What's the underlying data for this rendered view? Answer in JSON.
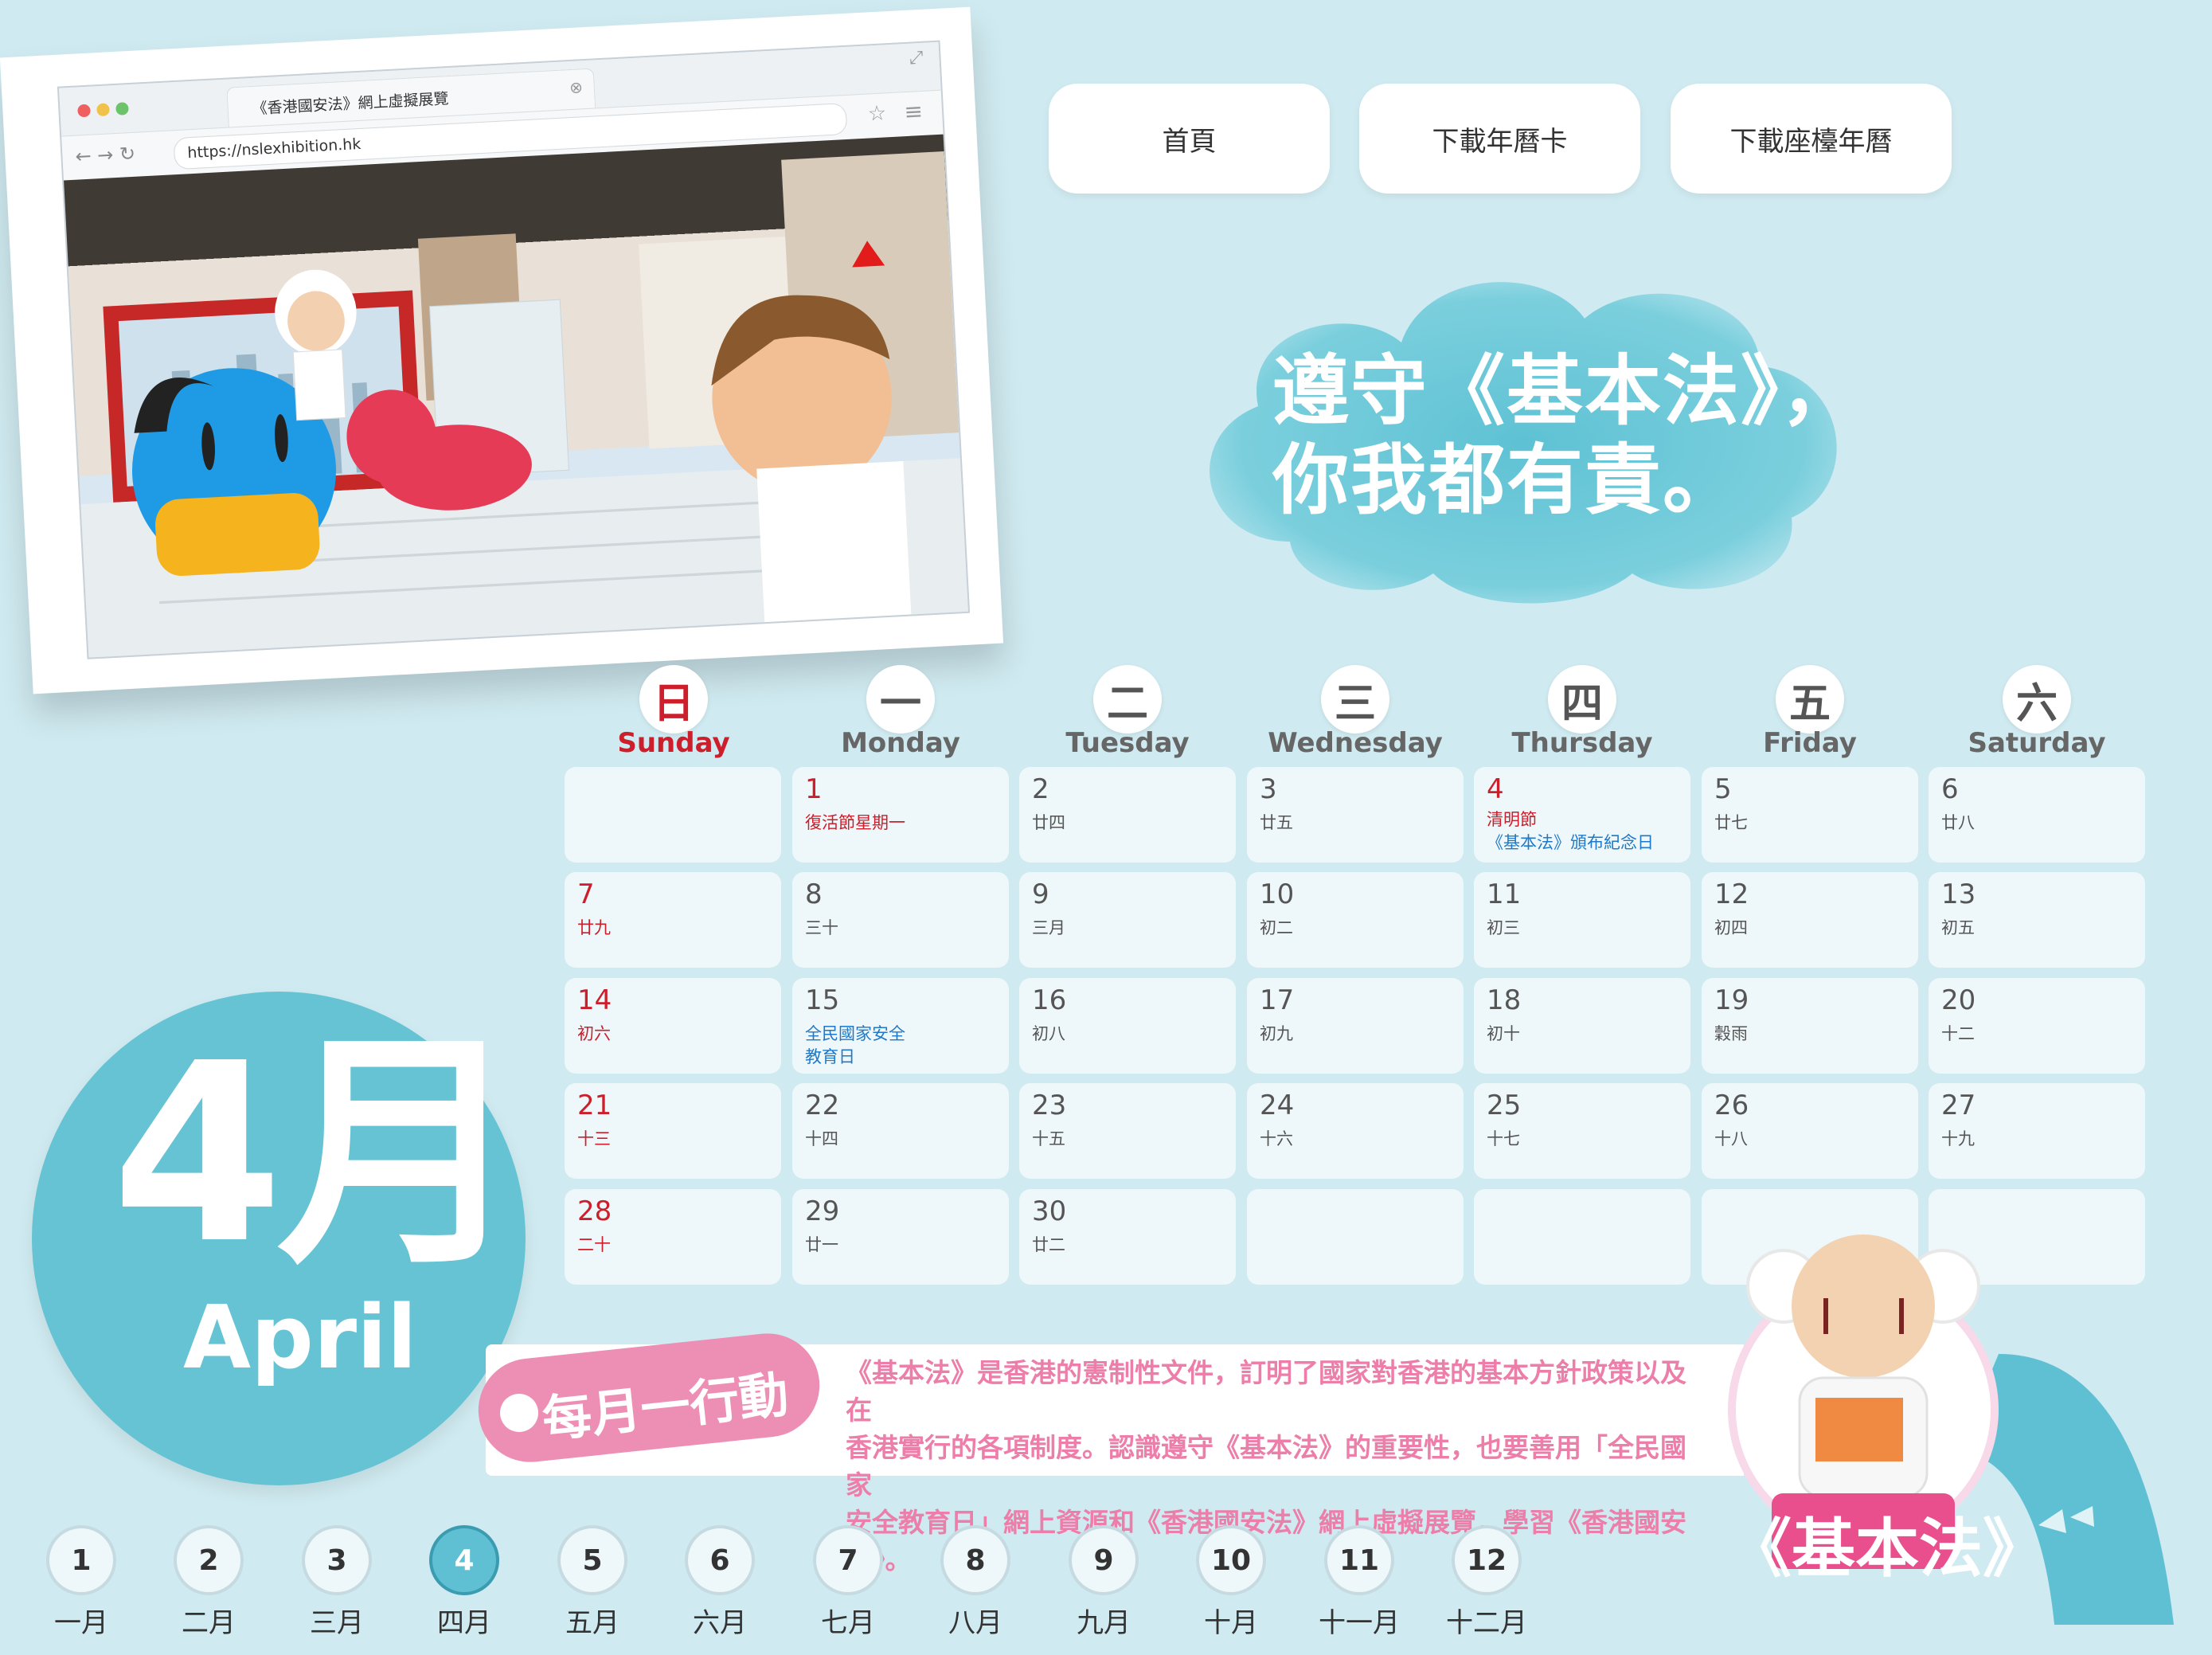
{
  "nav": {
    "home": "首頁",
    "download_card": "下載年曆卡",
    "download_desk": "下載座檯年曆"
  },
  "browser": {
    "tab_title": "《香港國安法》網上虛擬展覽",
    "url": "https://nslexhibition.hk"
  },
  "slogan": {
    "line1": "遵守《基本法》，",
    "line2": "你我都有責。"
  },
  "weekdays": [
    {
      "zh": "日",
      "en": "Sunday"
    },
    {
      "zh": "一",
      "en": "Monday"
    },
    {
      "zh": "二",
      "en": "Tuesday"
    },
    {
      "zh": "三",
      "en": "Wednesday"
    },
    {
      "zh": "四",
      "en": "Thursday"
    },
    {
      "zh": "五",
      "en": "Friday"
    },
    {
      "zh": "六",
      "en": "Saturday"
    }
  ],
  "calendar": {
    "weeks": [
      [
        {
          "day": "",
          "lunar": ""
        },
        {
          "day": "1",
          "lunar": "復活節星期一"
        },
        {
          "day": "2",
          "lunar": "廿四"
        },
        {
          "day": "3",
          "lunar": "廿五"
        },
        {
          "day": "4",
          "lunar": "清明節",
          "extra": "《基本法》頒布紀念日"
        },
        {
          "day": "5",
          "lunar": "廿七"
        },
        {
          "day": "6",
          "lunar": "廿八"
        }
      ],
      [
        {
          "day": "7",
          "lunar": "廿九"
        },
        {
          "day": "8",
          "lunar": "三十"
        },
        {
          "day": "9",
          "lunar": "三月"
        },
        {
          "day": "10",
          "lunar": "初二"
        },
        {
          "day": "11",
          "lunar": "初三"
        },
        {
          "day": "12",
          "lunar": "初四"
        },
        {
          "day": "13",
          "lunar": "初五"
        }
      ],
      [
        {
          "day": "14",
          "lunar": "初六"
        },
        {
          "day": "15",
          "lunar": "全民國家安全",
          "extra": "教育日"
        },
        {
          "day": "16",
          "lunar": "初八"
        },
        {
          "day": "17",
          "lunar": "初九"
        },
        {
          "day": "18",
          "lunar": "初十"
        },
        {
          "day": "19",
          "lunar": "穀雨"
        },
        {
          "day": "20",
          "lunar": "十二"
        }
      ],
      [
        {
          "day": "21",
          "lunar": "十三"
        },
        {
          "day": "22",
          "lunar": "十四"
        },
        {
          "day": "23",
          "lunar": "十五"
        },
        {
          "day": "24",
          "lunar": "十六"
        },
        {
          "day": "25",
          "lunar": "十七"
        },
        {
          "day": "26",
          "lunar": "十八"
        },
        {
          "day": "27",
          "lunar": "十九"
        }
      ],
      [
        {
          "day": "28",
          "lunar": "二十"
        },
        {
          "day": "29",
          "lunar": "廿一"
        },
        {
          "day": "30",
          "lunar": "廿二"
        },
        {
          "day": "",
          "lunar": ""
        },
        {
          "day": "",
          "lunar": ""
        },
        {
          "day": "",
          "lunar": ""
        },
        {
          "day": "",
          "lunar": ""
        }
      ]
    ]
  },
  "month": {
    "zh": "4月",
    "en": "April"
  },
  "action": {
    "title": "每月一行動",
    "line1": "《基本法》是香港的憲制性文件，訂明了國家對香港的基本方針政策以及在",
    "line2": "香港實行的各項制度。認識遵守《基本法》的重要性，也要善用「全民國家",
    "line3": "安全教育日」網上資源和《香港國安法》網上虛擬展覽，學習《香港國安法》。"
  },
  "badge": "《基本法》",
  "months": [
    {
      "num": "1",
      "label": "一月"
    },
    {
      "num": "2",
      "label": "二月"
    },
    {
      "num": "3",
      "label": "三月"
    },
    {
      "num": "4",
      "label": "四月"
    },
    {
      "num": "5",
      "label": "五月"
    },
    {
      "num": "6",
      "label": "六月"
    },
    {
      "num": "7",
      "label": "七月"
    },
    {
      "num": "8",
      "label": "八月"
    },
    {
      "num": "9",
      "label": "九月"
    },
    {
      "num": "10",
      "label": "十月"
    },
    {
      "num": "11",
      "label": "十一月"
    },
    {
      "num": "12",
      "label": "十二月"
    }
  ],
  "active_month": "4"
}
